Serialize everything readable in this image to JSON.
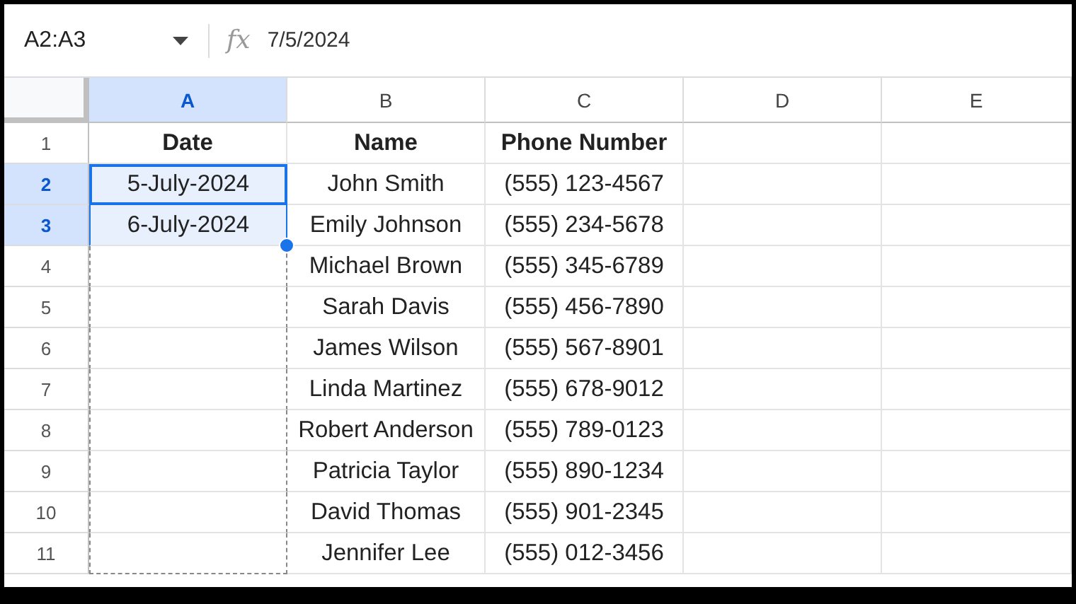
{
  "name_box": {
    "value": "A2:A3"
  },
  "formula_bar": {
    "fx": "fx",
    "value": "7/5/2024"
  },
  "columns": [
    {
      "label": "A",
      "selected": true
    },
    {
      "label": "B",
      "selected": false
    },
    {
      "label": "C",
      "selected": false
    },
    {
      "label": "D",
      "selected": false
    },
    {
      "label": "E",
      "selected": false
    }
  ],
  "rows": [
    {
      "number": "1",
      "selected": false,
      "active": false,
      "fill_preview": false,
      "cells": [
        "Date",
        "Name",
        "Phone Number"
      ],
      "header": true
    },
    {
      "number": "2",
      "selected": true,
      "active": true,
      "fill_preview": false,
      "cells": [
        "5-July-2024",
        "John Smith",
        "(555) 123-4567"
      ],
      "header": false
    },
    {
      "number": "3",
      "selected": true,
      "active": false,
      "fill_preview": false,
      "cells": [
        "6-July-2024",
        "Emily Johnson",
        "(555) 234-5678"
      ],
      "header": false
    },
    {
      "number": "4",
      "selected": false,
      "active": false,
      "fill_preview": true,
      "cells": [
        "",
        "Michael Brown",
        "(555) 345-6789"
      ],
      "header": false
    },
    {
      "number": "5",
      "selected": false,
      "active": false,
      "fill_preview": true,
      "cells": [
        "",
        "Sarah Davis",
        "(555) 456-7890"
      ],
      "header": false
    },
    {
      "number": "6",
      "selected": false,
      "active": false,
      "fill_preview": true,
      "cells": [
        "",
        "James Wilson",
        "(555) 567-8901"
      ],
      "header": false
    },
    {
      "number": "7",
      "selected": false,
      "active": false,
      "fill_preview": true,
      "cells": [
        "",
        "Linda Martinez",
        "(555) 678-9012"
      ],
      "header": false
    },
    {
      "number": "8",
      "selected": false,
      "active": false,
      "fill_preview": true,
      "cells": [
        "",
        "Robert Anderson",
        "(555) 789-0123"
      ],
      "header": false
    },
    {
      "number": "9",
      "selected": false,
      "active": false,
      "fill_preview": true,
      "cells": [
        "",
        "Patricia Taylor",
        "(555) 890-1234"
      ],
      "header": false
    },
    {
      "number": "10",
      "selected": false,
      "active": false,
      "fill_preview": true,
      "cells": [
        "",
        "David Thomas",
        "(555) 901-2345"
      ],
      "header": false
    },
    {
      "number": "11",
      "selected": false,
      "active": false,
      "fill_preview": true,
      "cells": [
        "",
        "Jennifer Lee",
        "(555) 012-3456"
      ],
      "header": false
    }
  ]
}
